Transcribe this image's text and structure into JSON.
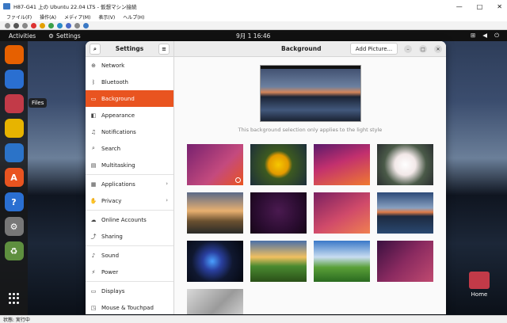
{
  "host": {
    "title": "H87-G41 上の Ubuntu 22.04 LTS - 仮想マシン接続",
    "menu": [
      "ファイル(F)",
      "操作(A)",
      "メディア(M)",
      "表示(V)",
      "ヘルプ(H)"
    ],
    "status": "状態: 実行中",
    "min": "—",
    "max": "□",
    "close": "✕"
  },
  "topbar": {
    "activities": "Activities",
    "app_name": "Settings",
    "clock": "9月 1 16:46"
  },
  "dock": {
    "tooltip": "Files",
    "apps": [
      {
        "name": "firefox",
        "glyph": "",
        "color": "#e66000"
      },
      {
        "name": "thunderbird",
        "glyph": "",
        "color": "#2a6fd1"
      },
      {
        "name": "files",
        "glyph": "",
        "color": "#c23a48"
      },
      {
        "name": "rhythmbox",
        "glyph": "",
        "color": "#e7b400"
      },
      {
        "name": "writer",
        "glyph": "",
        "color": "#2b73c8"
      },
      {
        "name": "app-center",
        "glyph": "A",
        "color": "#e95420"
      },
      {
        "name": "help",
        "glyph": "?",
        "color": "#2a6fd1"
      },
      {
        "name": "settings",
        "glyph": "⚙",
        "color": "#777777"
      },
      {
        "name": "trash",
        "glyph": "♻",
        "color": "#5e8f3f"
      }
    ]
  },
  "desktop": {
    "home_label": "Home"
  },
  "settings": {
    "sidebar_title": "Settings",
    "items": [
      {
        "label": "Network",
        "icon": "⊕",
        "has_chevron": false
      },
      {
        "label": "Bluetooth",
        "icon": "ᛒ",
        "has_chevron": false
      },
      {
        "label": "Background",
        "icon": "▭",
        "has_chevron": false,
        "active": true
      },
      {
        "label": "Appearance",
        "icon": "◧",
        "has_chevron": false
      },
      {
        "label": "Notifications",
        "icon": "♫",
        "has_chevron": false
      },
      {
        "label": "Search",
        "icon": "⌕",
        "has_chevron": false
      },
      {
        "label": "Multitasking",
        "icon": "▤",
        "has_chevron": false
      },
      {
        "label": "Applications",
        "icon": "▦",
        "has_chevron": true
      },
      {
        "label": "Privacy",
        "icon": "✋",
        "has_chevron": true
      },
      {
        "label": "Online Accounts",
        "icon": "☁",
        "has_chevron": false
      },
      {
        "label": "Sharing",
        "icon": "⤴",
        "has_chevron": false
      },
      {
        "label": "Sound",
        "icon": "♪",
        "has_chevron": false
      },
      {
        "label": "Power",
        "icon": "⚡",
        "has_chevron": false
      },
      {
        "label": "Displays",
        "icon": "▭",
        "has_chevron": false
      },
      {
        "label": "Mouse & Touchpad",
        "icon": "◳",
        "has_chevron": false
      }
    ],
    "main_title": "Background",
    "add_picture": "Add Picture...",
    "caption": "This background selection only applies to the light style",
    "wallpapers": [
      {
        "bg": "linear-gradient(135deg, #77216f 0%, #c44a7e 60%, #e95420 100%)",
        "selected": true
      },
      {
        "bg": "radial-gradient(circle at 50% 50%, #f6c700 0%, #e39a00 28%, #3d5a20 40%, #1c2e3a 100%)",
        "selected": false
      },
      {
        "bg": "linear-gradient(160deg, #5a1a6b 0%, #c2306e 45%, #f07a30 100%)",
        "selected": false
      },
      {
        "bg": "radial-gradient(circle at 50% 50%, #ffffff 0%, #f2e8e8 30%, #4a5a48 60%, #2a2e30 100%)",
        "selected": false
      },
      {
        "bg": "linear-gradient(180deg, #5a6a88 0%, #e8b070 45%, #6a5030 70%, #2a2a28 100%)",
        "selected": false
      },
      {
        "bg": "radial-gradient(circle at 50% 45%, #4a1a50 0%, #2a0c30 60%, #160616 100%)",
        "selected": false
      },
      {
        "bg": "linear-gradient(150deg, #7a2060 0%, #d04a6a 55%, #f08050 100%)",
        "selected": false
      },
      {
        "bg": "linear-gradient(180deg, #2c4a78 0%, #88a0c0 38%, #e07c48 48%, #1c2a40 58%, #2a4870 100%)",
        "selected": false
      },
      {
        "bg": "radial-gradient(circle at 45% 50%, #4aa0ff 0%, #2a40a0 25%, #101830 55%, #050810 100%)",
        "selected": false
      },
      {
        "bg": "linear-gradient(180deg, #4a70a8 0%, #f0c060 40%, #4a8a30 62%, #2a5018 100%)",
        "selected": false
      },
      {
        "bg": "linear-gradient(180deg, #3a78c8 0%, #c8dcf0 40%, #5aa038 65%, #2a6a20 100%)",
        "selected": false
      },
      {
        "bg": "linear-gradient(135deg, #3a1040 0%, #8a2a60 50%, #c04a70 100%)",
        "selected": false
      },
      {
        "bg": "linear-gradient(135deg, #d8d8d8 0%, #9a9a9a 50%, #e6e6e6 100%)",
        "selected": false
      }
    ]
  }
}
